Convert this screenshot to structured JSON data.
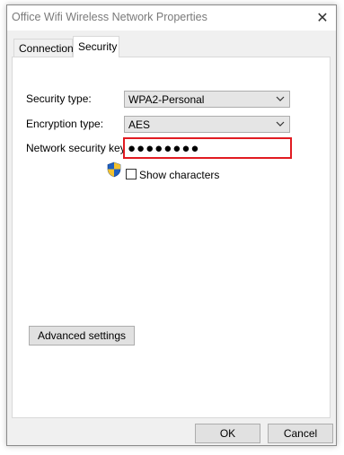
{
  "window": {
    "title": "Office Wifi Wireless Network Properties",
    "close_glyph": "✕"
  },
  "tabs": [
    {
      "label": "Connection",
      "selected": false
    },
    {
      "label": "Security",
      "selected": true
    }
  ],
  "security": {
    "security_type_label": "Security type:",
    "security_type_value": "WPA2-Personal",
    "encryption_type_label": "Encryption type:",
    "encryption_type_value": "AES",
    "network_key_label": "Network security key",
    "network_key_value": "●●●●●●●●",
    "show_characters_label": "Show characters",
    "show_characters_checked": false,
    "advanced_settings_label": "Advanced settings"
  },
  "footer": {
    "ok_label": "OK",
    "cancel_label": "Cancel"
  },
  "colors": {
    "highlight_border": "#e11b22",
    "shield_blue": "#1f5fbf",
    "shield_yellow": "#f2c12e"
  },
  "icons": [
    "close-icon",
    "chevron-down-icon",
    "shield-icon"
  ]
}
